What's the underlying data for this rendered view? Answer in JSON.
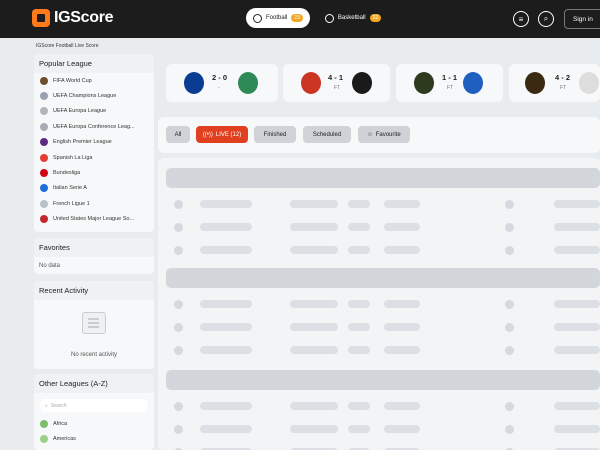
{
  "header": {
    "logo_text": "IGScore",
    "tabs": [
      {
        "label": "Football",
        "count": "23"
      },
      {
        "label": "Basketball",
        "count": "22"
      }
    ],
    "signin_label": "Sign in"
  },
  "breadcrumb": "IGScore Football Live Score",
  "sidebar": {
    "popular_title": "Popular League",
    "leagues": [
      {
        "label": "FIFA World Cup",
        "color": "#6b4f2a"
      },
      {
        "label": "UEFA Champions League",
        "color": "#9aa3ad"
      },
      {
        "label": "UEFA Europa League",
        "color": "#b0b6bc"
      },
      {
        "label": "UEFA Europa Conference Leag...",
        "color": "#a6adb4"
      },
      {
        "label": "English Premier League",
        "color": "#5b2d82"
      },
      {
        "label": "Spanish La Liga",
        "color": "#e43d30"
      },
      {
        "label": "Bundesliga",
        "color": "#d20515"
      },
      {
        "label": "Italian Serie A",
        "color": "#1d6fd8"
      },
      {
        "label": "French Ligue 1",
        "color": "#b8c2cc"
      },
      {
        "label": "United States Major League So...",
        "color": "#c4262e"
      }
    ],
    "favorites_title": "Favorites",
    "favorites_empty": "No data",
    "recent_title": "Recent Activity",
    "recent_empty": "No recent activity",
    "other_title": "Other Leagues (A-Z)",
    "search_placeholder": "Search",
    "regions": [
      {
        "label": "Africa"
      },
      {
        "label": "Americas"
      }
    ]
  },
  "matches": [
    {
      "score": "2 - 0",
      "status": "-",
      "home_color": "#0a3d91",
      "away_color": "#2e8b57"
    },
    {
      "score": "4 - 1",
      "status": "FT",
      "home_color": "#cb3524",
      "away_color": "#1a1a1a"
    },
    {
      "score": "1 - 1",
      "status": "FT",
      "home_color": "#2d3a1e",
      "away_color": "#1e5fbf"
    },
    {
      "score": "4 - 2",
      "status": "FT",
      "home_color": "#3a2a12",
      "away_color": "#dddddd"
    }
  ],
  "filters": [
    {
      "label": "All"
    },
    {
      "label": "LIVE (12)"
    },
    {
      "label": "Finished"
    },
    {
      "label": "Scheduled"
    },
    {
      "label": "Favourite"
    }
  ],
  "colors": {
    "accent": "#ff7a1a",
    "live": "#e0401f",
    "header_bg": "#1c1c1c"
  }
}
